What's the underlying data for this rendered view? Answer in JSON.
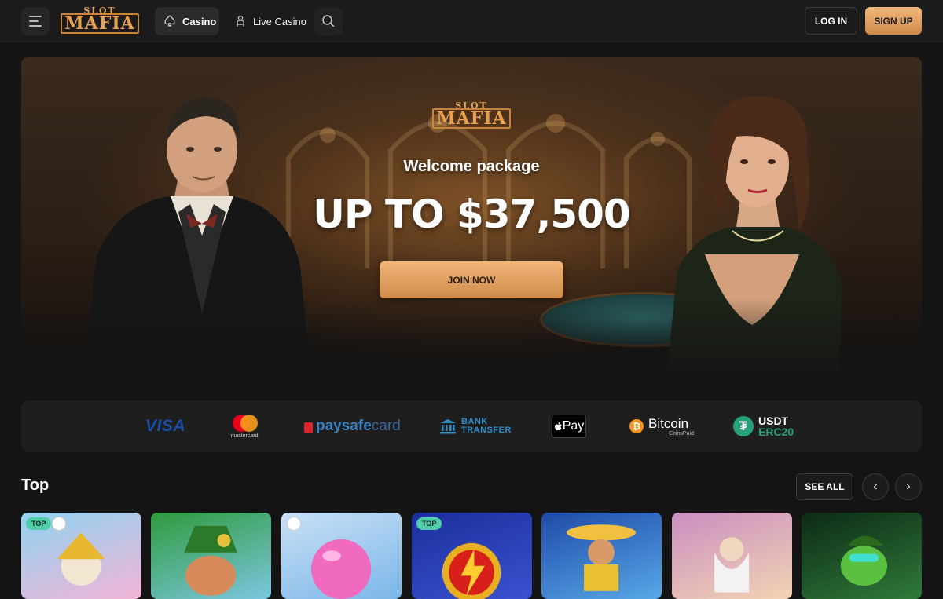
{
  "header": {
    "logo_small": "SLOT",
    "logo_big": "MAFIA",
    "nav": [
      {
        "label": "Casino",
        "icon": "spade-icon",
        "active": true
      },
      {
        "label": "Live Casino",
        "icon": "dealer-icon",
        "active": false
      }
    ],
    "login_label": "LOG IN",
    "signup_label": "SIGN UP"
  },
  "hero": {
    "logo_small": "SLOT",
    "logo_big": "MAFIA",
    "subtitle": "Welcome package",
    "amount": "UP TO $37,500",
    "cta_label": "JOIN NOW"
  },
  "payments": {
    "visa": "VISA",
    "mastercard": "mastercard",
    "paysafe_a": "paysafe",
    "paysafe_b": "card",
    "bank_line1": "BANK",
    "bank_line2": "TRANSFER",
    "applepay": "Pay",
    "bitcoin": "Bitcoin",
    "bitcoin_by": "CoinsPaid",
    "usdt_line1": "USDT",
    "usdt_line2": "ERC20"
  },
  "top_section": {
    "title": "Top",
    "see_all_label": "SEE ALL",
    "games": [
      {
        "badge": "TOP",
        "provider_badge": true,
        "bg1": "#8fd3f0",
        "bg2": "#f3b4d6"
      },
      {
        "badge": "",
        "provider_badge": false,
        "bg1": "#2f9a3d",
        "bg2": "#7cc7e0"
      },
      {
        "badge": "",
        "provider_badge": true,
        "bg1": "#c9e0f5",
        "bg2": "#7bb6e9"
      },
      {
        "badge": "TOP",
        "provider_badge": false,
        "bg1": "#1b2f9a",
        "bg2": "#3a52d1"
      },
      {
        "badge": "",
        "provider_badge": false,
        "bg1": "#1e4aa8",
        "bg2": "#58a8e8"
      },
      {
        "badge": "",
        "provider_badge": false,
        "bg1": "#c98fc0",
        "bg2": "#f3d3b3"
      },
      {
        "badge": "",
        "provider_badge": false,
        "bg1": "#0d2a15",
        "bg2": "#2f7a3a"
      }
    ]
  }
}
